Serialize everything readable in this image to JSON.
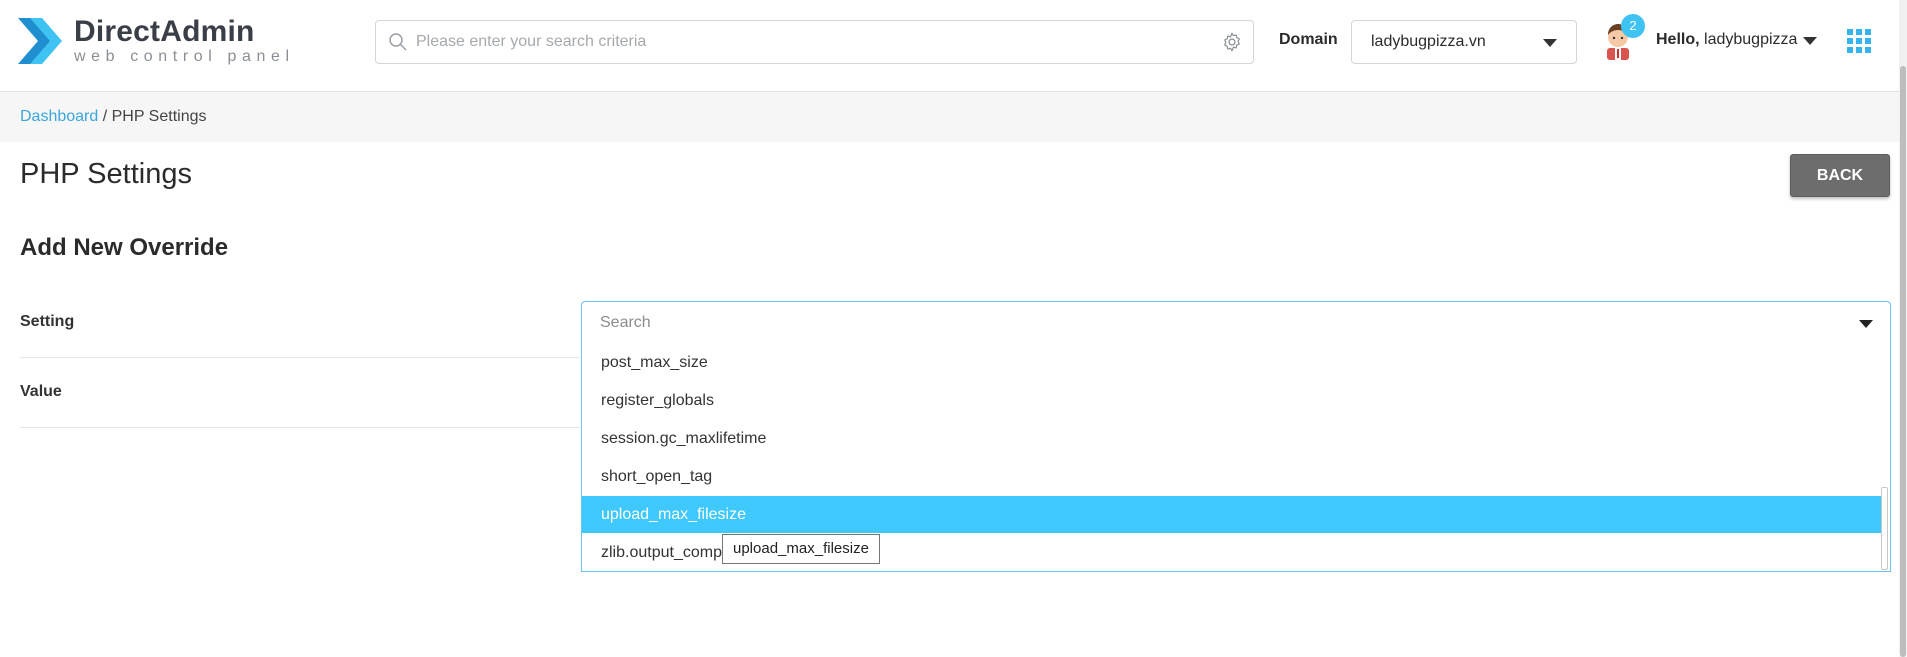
{
  "header": {
    "logo": {
      "title": "DirectAdmin",
      "subtitle": "web control panel"
    },
    "search": {
      "placeholder": "Please enter your search criteria"
    },
    "domain": {
      "label": "Domain",
      "selected": "ladybugpizza.vn"
    },
    "user": {
      "notification_count": "2",
      "greeting": "Hello,",
      "username": "ladybugpizza"
    }
  },
  "breadcrumb": {
    "home": "Dashboard",
    "separator": " / ",
    "current": "PHP Settings"
  },
  "page": {
    "title": "PHP Settings",
    "back_label": "BACK",
    "section_title": "Add New Override"
  },
  "form": {
    "setting_label": "Setting",
    "value_label": "Value",
    "select_placeholder": "Search",
    "options": [
      {
        "label": "post_max_size",
        "selected": false
      },
      {
        "label": "register_globals",
        "selected": false
      },
      {
        "label": "session.gc_maxlifetime",
        "selected": false
      },
      {
        "label": "short_open_tag",
        "selected": false
      },
      {
        "label": "upload_max_filesize",
        "selected": true
      },
      {
        "label": "zlib.output_comp",
        "selected": false
      }
    ],
    "tooltip": "upload_max_filesize"
  },
  "colors": {
    "accent": "#3ec8fb",
    "link": "#3aa6dc",
    "back_button": "#6d6d6d"
  }
}
